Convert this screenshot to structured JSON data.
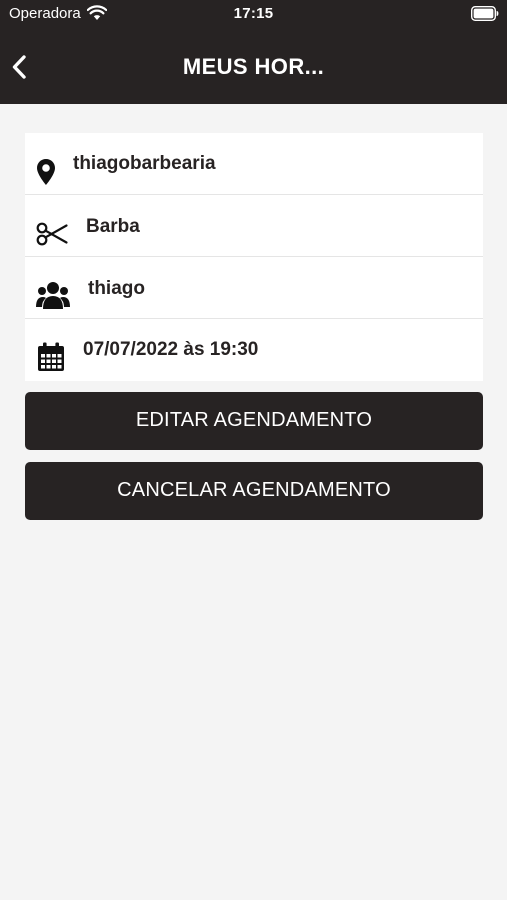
{
  "status_bar": {
    "carrier": "Operadora",
    "time": "17:15"
  },
  "nav": {
    "title": "MEUS HOR..."
  },
  "appointment": {
    "location": "thiagobarbearia",
    "service": "Barba",
    "professional": "thiago",
    "datetime": "07/07/2022 às 19:30"
  },
  "actions": {
    "edit_label": "EDITAR AGENDAMENTO",
    "cancel_label": "CANCELAR AGENDAMENTO"
  },
  "colors": {
    "header_bg": "#272323",
    "page_bg": "#f4f4f4",
    "button_bg": "#272323",
    "button_text": "#ffffff"
  },
  "icons": [
    "wifi-icon",
    "battery-icon",
    "back-chevron-icon",
    "location-pin-icon",
    "scissors-icon",
    "users-icon",
    "calendar-icon"
  ]
}
